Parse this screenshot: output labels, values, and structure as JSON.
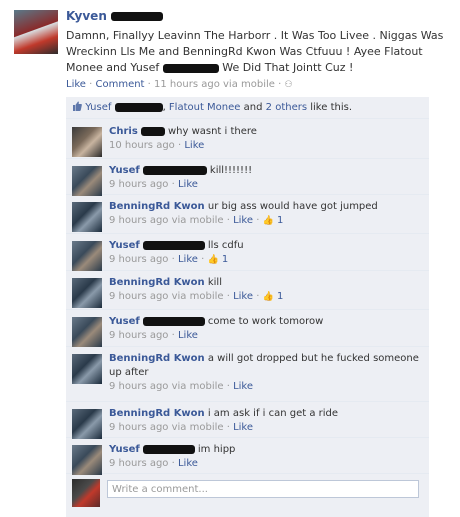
{
  "post": {
    "author": "Kyven",
    "message": "Damnn, Finallyy Leavinn The Harborr . It Was Too Livee . Niggas Was Wreckinn Lls Me and BenningRd Kwon Was Ctfuuu ! Ayee Flatout Monee and Yusef",
    "message_end": "We Did That Jointt Cuz !",
    "mention_bennington": "BenningRd Kwon",
    "mention_flatout": "Flatout Monee",
    "mention_yusef": "Yusef",
    "like_label": "Like",
    "comment_label": "Comment",
    "time": "11 hours ago via mobile"
  },
  "likes": {
    "name1": "Yusef",
    "name2": "Flatout Monee",
    "and": "and",
    "others": "2 others",
    "suffix": "like this."
  },
  "comments": [
    {
      "name": "Chris",
      "text": "why wasnt i there",
      "time": "10 hours ago",
      "like": "Like",
      "likes_count": ""
    },
    {
      "name": "Yusef",
      "text": "kill!!!!!!!",
      "time": "9 hours ago",
      "like": "Like",
      "likes_count": ""
    },
    {
      "name": "BenningRd Kwon",
      "text": "ur big ass would have got jumped",
      "time": "9 hours ago via mobile",
      "like": "Like",
      "likes_count": "1"
    },
    {
      "name": "Yusef",
      "text": "lls cdfu",
      "time": "9 hours ago",
      "like": "Like",
      "likes_count": "1"
    },
    {
      "name": "BenningRd Kwon",
      "text": "kill",
      "time": "9 hours ago via mobile",
      "like": "Like",
      "likes_count": "1"
    },
    {
      "name": "Yusef",
      "text": "come to work tomorow",
      "time": "9 hours ago",
      "like": "Like",
      "likes_count": ""
    },
    {
      "name": "BenningRd Kwon",
      "text": "a will got dropped but he fucked someone up after",
      "time": "9 hours ago via mobile",
      "like": "Like",
      "likes_count": ""
    },
    {
      "name": "BenningRd Kwon",
      "text": "i am ask if i can get a ride",
      "time": "9 hours ago via mobile",
      "like": "Like",
      "likes_count": ""
    },
    {
      "name": "Yusef",
      "text": "im hipp",
      "time": "9 hours ago",
      "like": "Like",
      "likes_count": ""
    }
  ],
  "input": {
    "placeholder": "Write a comment..."
  },
  "colors": {
    "link": "#3b5998",
    "feedback_bg": "#edeff4",
    "meta": "#999999"
  }
}
